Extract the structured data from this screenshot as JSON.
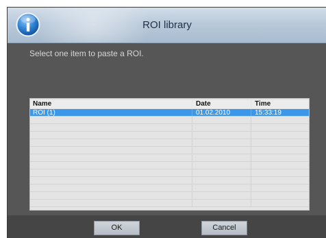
{
  "dialog": {
    "title": "ROI library",
    "instruction": "Select one item to paste a ROI.",
    "icon": "info-icon"
  },
  "list": {
    "columns": [
      "Name",
      "Date",
      "Time"
    ],
    "rows": [
      {
        "name": "ROI (1)",
        "date": "01.02.2010",
        "time": "15:33:19",
        "selected": true
      }
    ]
  },
  "buttons": {
    "ok_label": "OK",
    "cancel_label": "Cancel"
  },
  "colors": {
    "selection": "#3d97e8",
    "dialog_background": "#565656",
    "title_text": "#1e2f48"
  }
}
